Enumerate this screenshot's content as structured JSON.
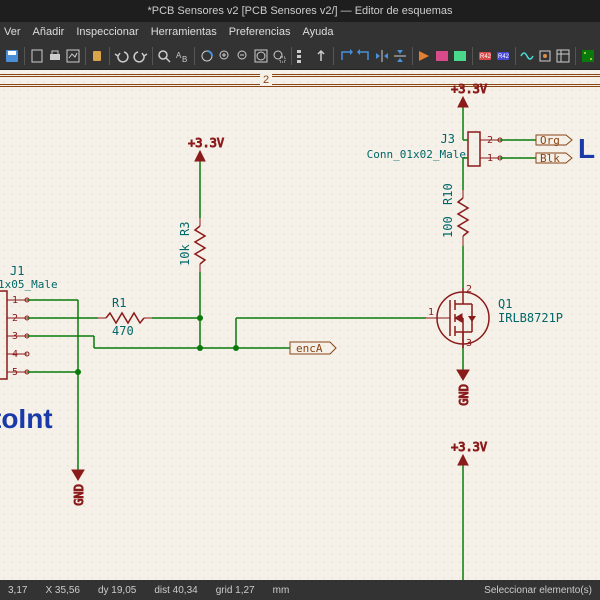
{
  "title": "*PCB Sensores v2 [PCB Sensores v2/] — Editor de esquemas",
  "menu": [
    "Ver",
    "Añadir",
    "Inspeccionar",
    "Herramientas",
    "Preferencias",
    "Ayuda"
  ],
  "ruler": {
    "num": "2"
  },
  "power": {
    "v33": "+3.3V",
    "gnd": "GND"
  },
  "components": {
    "J1": {
      "ref": "J1",
      "val": "1x05_Male"
    },
    "J3": {
      "ref": "J3",
      "val": "Conn_01x02_Male"
    },
    "R1": {
      "ref": "R1",
      "val": "470"
    },
    "R3": {
      "ref": "R3",
      "val": "10k"
    },
    "R10": {
      "ref": "R10",
      "val": "100"
    },
    "Q1": {
      "ref": "Q1",
      "val": "IRLB8721P"
    }
  },
  "pins": {
    "p1": "1",
    "p2": "2",
    "p3": "3",
    "p4": "4",
    "p5": "5"
  },
  "netlabels": {
    "encA": "encA",
    "org": "Org",
    "blk": "Blk"
  },
  "text": {
    "toInt": "toInt",
    "L": "L"
  },
  "status": {
    "coord1": "3,17",
    "coord2": "X 35,56",
    "coord3": "dy 19,05",
    "coord4": "dist 40,34",
    "grid": "grid 1,27",
    "unit": "mm",
    "hint": "Seleccionar elemento(s)"
  }
}
